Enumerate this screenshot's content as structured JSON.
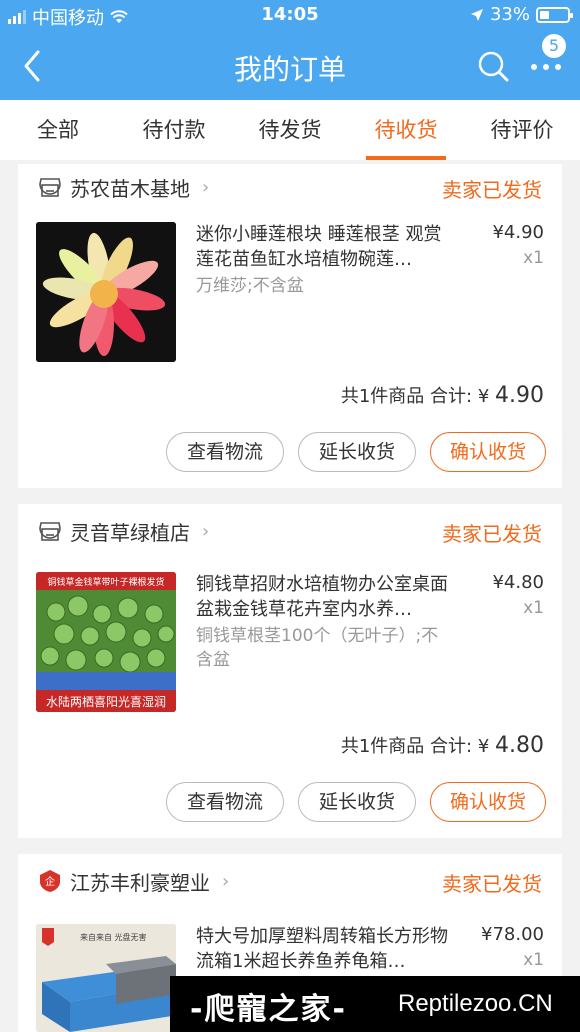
{
  "status_bar": {
    "carrier": "中国移动",
    "time": "14:05",
    "battery": "33%"
  },
  "nav": {
    "title": "我的订单",
    "badge_count": "5"
  },
  "tabs": [
    {
      "label": "全部"
    },
    {
      "label": "待付款"
    },
    {
      "label": "待发货"
    },
    {
      "label": "待收货",
      "active": true
    },
    {
      "label": "待评价"
    }
  ],
  "orders": [
    {
      "shop": "苏农苗木基地",
      "status": "卖家已发货",
      "title": "迷你小睡莲根块 睡莲根茎 观赏莲花苗鱼缸水培植物碗莲…",
      "spec": "万维莎;不含盆",
      "price": "¥4.90",
      "qty": "x1",
      "summary_count": "共1件商品",
      "summary_label": "合计:",
      "summary_currency": "¥",
      "summary_total": "4.90",
      "btn_logistics": "查看物流",
      "btn_extend": "延长收货",
      "btn_confirm": "确认收货"
    },
    {
      "shop": "灵音草绿植店",
      "status": "卖家已发货",
      "title": "铜钱草招财水培植物办公室桌面盆栽金钱草花卉室内水养…",
      "spec": "铜钱草根茎100个（无叶子）;不含盆",
      "price": "¥4.80",
      "qty": "x1",
      "summary_count": "共1件商品",
      "summary_label": "合计:",
      "summary_currency": "¥",
      "summary_total": "4.80",
      "btn_logistics": "查看物流",
      "btn_extend": "延长收货",
      "btn_confirm": "确认收货",
      "img_top_text": "铜钱草金钱草带叶子裸根发货",
      "img_bottom_text": "水陆两栖喜阳光喜湿润"
    },
    {
      "shop": "江苏丰利豪塑业",
      "status": "卖家已发货",
      "title": "特大号加厚塑料周转箱长方形物流箱1米超长养鱼养龟箱…",
      "price": "¥78.00",
      "qty": "x1",
      "img_text": "来自来自    光盘无害"
    }
  ],
  "watermark": {
    "left": "-爬寵之家-",
    "right": "Reptilezoo.CN"
  },
  "colors": {
    "header": "#4aa7f0",
    "accent": "#f26a1b"
  }
}
